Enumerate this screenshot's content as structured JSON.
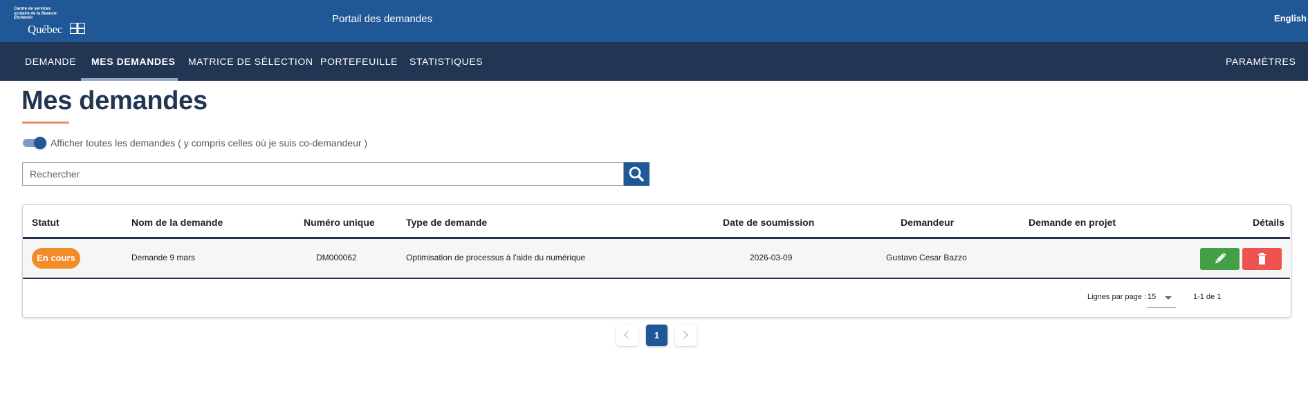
{
  "header": {
    "logo_org": "Centre de services scolaire de la Beauce-Etchemin",
    "logo_gov": "Québec",
    "portal_title": "Portail des demandes",
    "language_link": "English"
  },
  "nav": {
    "items": [
      {
        "label": "DEMANDE"
      },
      {
        "label": "MES DEMANDES"
      },
      {
        "label": "MATRICE DE SÉLECTION"
      },
      {
        "label": "PORTEFEUILLE"
      },
      {
        "label": "STATISTIQUES"
      }
    ],
    "settings": "PARAMÈTRES",
    "active": "MES DEMANDES"
  },
  "page": {
    "title": "Mes demandes",
    "toggle_label": "Afficher toutes les demandes ( y compris celles où je suis co-demandeur )",
    "toggle_on": true,
    "search_placeholder": "Rechercher",
    "search_value": ""
  },
  "table": {
    "columns": [
      "Statut",
      "Nom de la demande",
      "Numéro unique",
      "Type de demande",
      "Date de soumission",
      "Demandeur",
      "Demande en projet",
      "Détails"
    ],
    "rows": [
      {
        "status": "En cours",
        "name": "Demande 9 mars",
        "id": "DM000062",
        "type": "Optimisation de processus à l'aide du numérique",
        "date": "2026-03-09",
        "requester": "Gustavo Cesar Bazzo",
        "project": ""
      }
    ],
    "footer": {
      "rows_per_page_label": "Lignes par page :",
      "rows_per_page": "15",
      "range": "1-1 de 1"
    }
  },
  "pagination": {
    "current": "1"
  },
  "colors": {
    "header_blue": "#1f5797",
    "nav_dark": "#223654",
    "status_orange": "#f28c28",
    "edit_green": "#43a047",
    "delete_red": "#ef5350",
    "accent": "#f08a5d"
  },
  "icons": {
    "search": "search-icon",
    "edit": "pencil-icon",
    "delete": "trash-icon",
    "prev": "chevron-left-icon",
    "next": "chevron-right-icon",
    "rpp": "caret-down-icon"
  }
}
